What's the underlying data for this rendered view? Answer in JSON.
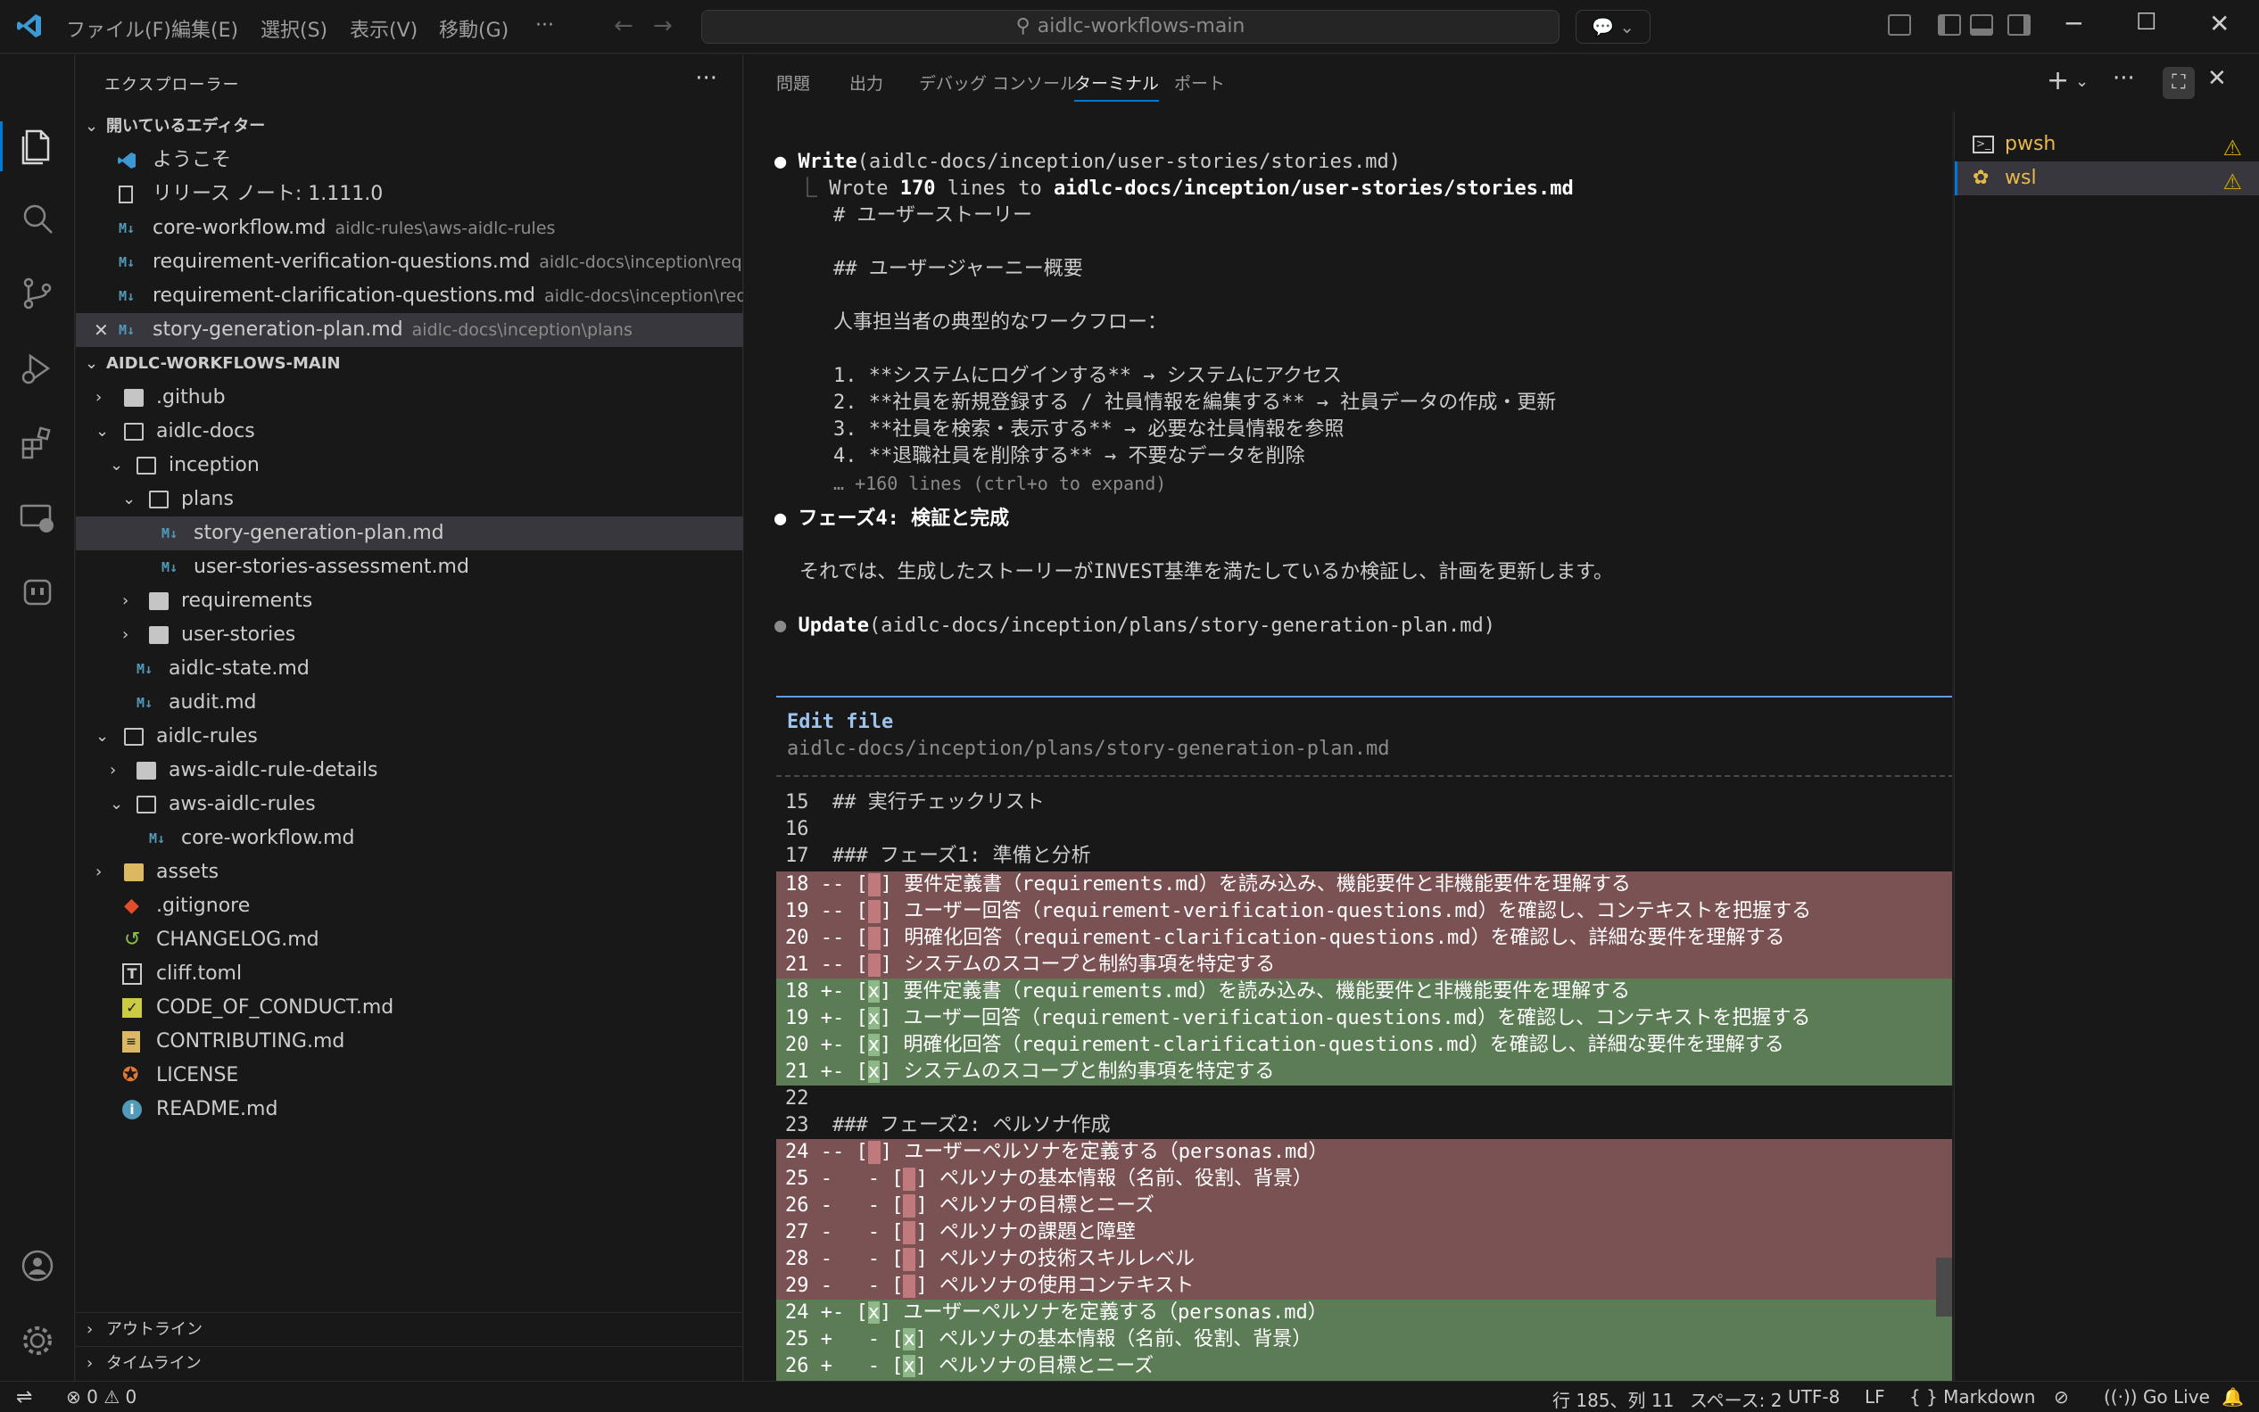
{
  "titlebar": {
    "menus": [
      "ファイル(F)",
      "編集(E)",
      "選択(S)",
      "表示(V)",
      "移動(G)",
      "···"
    ],
    "search": "aidlc-workflows-main",
    "window_controls": [
      "─",
      "☐",
      "✕"
    ]
  },
  "sidebar": {
    "title": "エクスプローラー",
    "open_editors_header": "開いているエディター",
    "open_editors": [
      {
        "name": "ようこそ",
        "desc": ""
      },
      {
        "name": "リリース ノート: 1.111.0",
        "desc": ""
      },
      {
        "name": "core-workflow.md",
        "desc": "aidlc-rules\\aws-aidlc-rules"
      },
      {
        "name": "requirement-verification-questions.md",
        "desc": "aidlc-docs\\inception\\requir..."
      },
      {
        "name": "requirement-clarification-questions.md",
        "desc": "aidlc-docs\\inception\\requi..."
      },
      {
        "name": "story-generation-plan.md",
        "desc": "aidlc-docs\\inception\\plans"
      }
    ],
    "workspace_header": "AIDLC-WORKFLOWS-MAIN",
    "tree": [
      ".github",
      "aidlc-docs",
      "inception",
      "plans",
      "story-generation-plan.md",
      "user-stories-assessment.md",
      "requirements",
      "user-stories",
      "aidlc-state.md",
      "audit.md",
      "aidlc-rules",
      "aws-aidlc-rule-details",
      "aws-aidlc-rules",
      "core-workflow.md",
      "assets",
      ".gitignore",
      "CHANGELOG.md",
      "cliff.toml",
      "CODE_OF_CONDUCT.md",
      "CONTRIBUTING.md",
      "LICENSE",
      "README.md"
    ],
    "outline": "アウトライン",
    "timeline": "タイムライン"
  },
  "panel": {
    "tabs": [
      "問題",
      "出力",
      "デバッグ コンソール",
      "ターミナル",
      "ポート"
    ]
  },
  "terminal": {
    "l1_cmd": "Write",
    "l1_arg": "(aidlc-docs/inception/user-stories/stories.md)",
    "l2_pre": "Wrote ",
    "l2_num": "170",
    "l2_mid": " lines to ",
    "l2_path": "aidlc-docs/inception/user-stories/stories.md",
    "l3": "# ユーザーストーリー",
    "l4": "## ユーザージャーニー概要",
    "l5": "人事担当者の典型的なワークフロー：",
    "l6": "1. **システムにログインする** → システムにアクセス",
    "l7": "2. **社員を新規登録する / 社員情報を編集する** → 社員データの作成・更新",
    "l8": "3. **社員を検索・表示する** → 必要な社員情報を参照",
    "l9": "4. **退職社員を削除する** → 不要なデータを削除",
    "l10": "… +160 lines (ctrl+o to expand)",
    "l11": "フェーズ4: 検証と完成",
    "l12": "それでは、生成したストーリーがINVEST基準を満たしているか検証し、計画を更新します。",
    "l13_cmd": "Update",
    "l13_arg": "(aidlc-docs/inception/plans/story-generation-plan.md)",
    "edit_title": "Edit file",
    "edit_path": "aidlc-docs/inception/plans/story-generation-plan.md",
    "d15": "15  ## 実行チェックリスト",
    "d16": "16",
    "d17": "17  ### フェーズ1: 準備と分析",
    "del1_a": "18 -- [",
    "del1_b": "] 要件定義書（requirements.md）を読み込み、機能要件と非機能要件を理解する",
    "del2_a": "19 -- [",
    "del2_b": "] ユーザー回答（requirement-verification-questions.md）を確認し、コンテキストを把握する",
    "del3_a": "20 -- [",
    "del3_b": "] 明確化回答（requirement-clarification-questions.md）を確認し、詳細な要件を理解する",
    "del4_a": "21 -- [",
    "del4_b": "] システムのスコープと制約事項を特定する",
    "add1_a": "18 +- [",
    "add1_b": "] 要件定義書（requirements.md）を読み込み、機能要件と非機能要件を理解する",
    "add2_a": "19 +- [",
    "add2_b": "] ユーザー回答（requirement-verification-questions.md）を確認し、コンテキストを把握する",
    "add3_a": "20 +- [",
    "add3_b": "] 明確化回答（requirement-clarification-questions.md）を確認し、詳細な要件を理解する",
    "add4_a": "21 +- [",
    "add4_b": "] システムのスコープと制約事項を特定する",
    "d22": "22",
    "d23": "23  ### フェーズ2: ペルソナ作成",
    "del5_a": "24 -- [",
    "del5_b": "] ユーザーペルソナを定義する（personas.md）",
    "del6_a": "25 -   - [",
    "del6_b": "] ペルソナの基本情報（名前、役割、背景）",
    "del7_a": "26 -   - [",
    "del7_b": "] ペルソナの目標とニーズ",
    "del8_a": "27 -   - [",
    "del8_b": "] ペルソナの課題と障壁",
    "del9_a": "28 -   - [",
    "del9_b": "] ペルソナの技術スキルレベル",
    "del10_a": "29 -   - [",
    "del10_b": "] ペルソナの使用コンテキスト",
    "add5_a": "24 +- [",
    "add5_b": "] ユーザーペルソナを定義する（personas.md）",
    "add6_a": "25 +   - [",
    "add6_b": "] ペルソナの基本情報（名前、役割、背景）",
    "add7_a": "26 +   - [",
    "add7_b": "] ペルソナの目標とニーズ",
    "check": "x"
  },
  "termlist": {
    "items": [
      "pwsh",
      "wsl"
    ]
  },
  "statusbar": {
    "errors": "0",
    "warnings": "0",
    "position": "行 185、列 11",
    "spaces": "スペース: 2",
    "encoding": "UTF-8",
    "eol": "LF",
    "language": "Markdown",
    "golive": "Go Live"
  },
  "colors": {
    "accent": "#0078d4",
    "diff_removed": "#7b5253",
    "diff_added": "#5c7c56",
    "warning": "#cca700",
    "markdown_icon": "#519aba"
  }
}
